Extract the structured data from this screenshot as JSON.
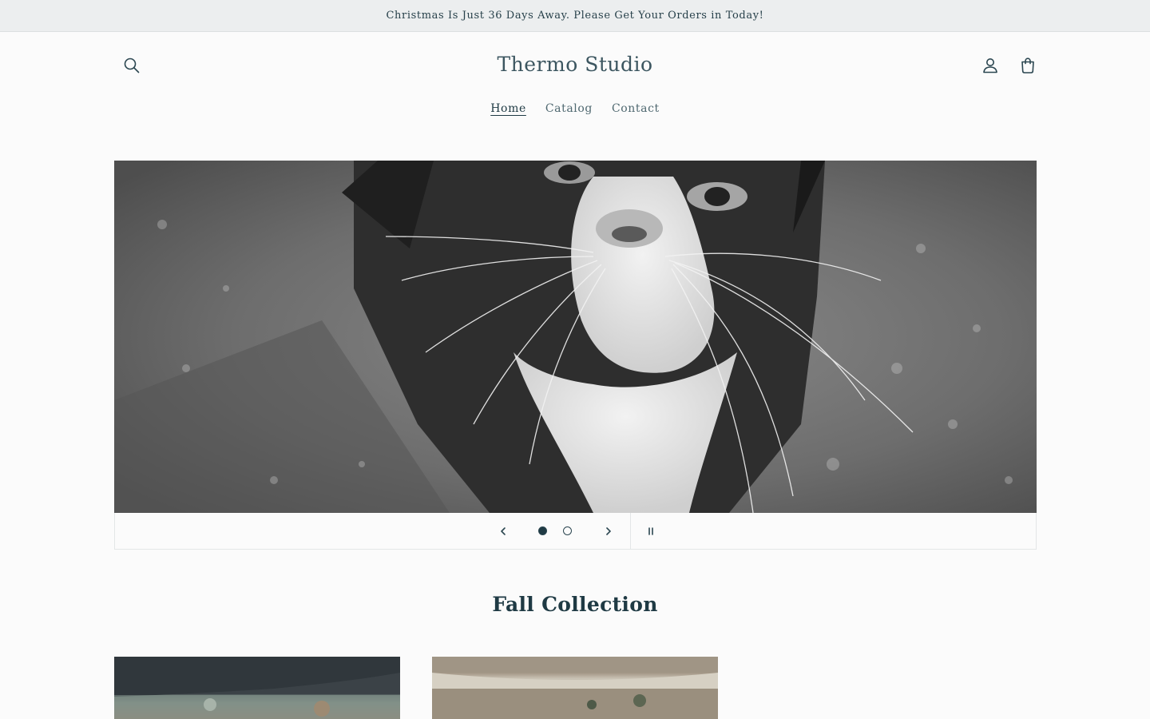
{
  "announcement": {
    "text": "Christmas Is Just 36 Days Away. Please Get Your Orders in Today!"
  },
  "header": {
    "logo": "Thermo Studio",
    "nav": [
      {
        "label": "Home",
        "active": true
      },
      {
        "label": "Catalog",
        "active": false
      },
      {
        "label": "Contact",
        "active": false
      }
    ],
    "icons": {
      "search": "search-icon",
      "account": "account-icon",
      "cart": "cart-icon"
    }
  },
  "slideshow": {
    "slides_total": 2,
    "current_slide": 1,
    "controls": {
      "previous": "chevron-left-icon",
      "next": "chevron-right-icon",
      "pause": "pause-icon"
    }
  },
  "collection": {
    "title": "Fall Collection"
  },
  "colors": {
    "background": "#fbfbfb",
    "text": "#1f3a44",
    "announcement_bg": "#eceeef"
  }
}
